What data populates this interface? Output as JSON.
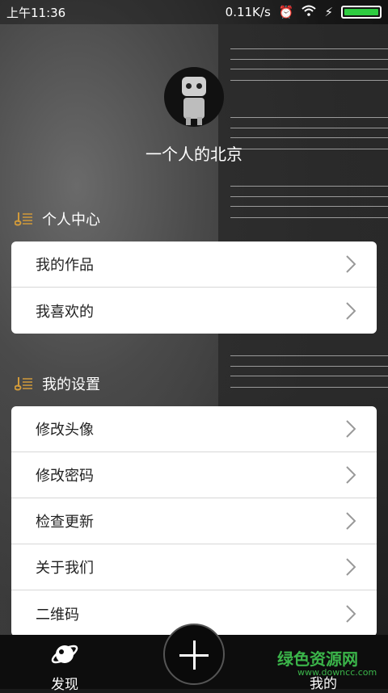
{
  "status_bar": {
    "time": "上午11:36",
    "speed": "0.11K/s"
  },
  "profile": {
    "username": "一个人的北京"
  },
  "sections": [
    {
      "title": "个人中心",
      "items": [
        "我的作品",
        "我喜欢的"
      ]
    },
    {
      "title": "我的设置",
      "items": [
        "修改头像",
        "修改密码",
        "检查更新",
        "关于我们",
        "二维码"
      ]
    }
  ],
  "tabbar": {
    "discover": "发现",
    "mine": "我的"
  },
  "watermark": {
    "text": "绿色资源网",
    "sub": "www.downcc.com"
  },
  "colors": {
    "accent_icon": "#d19a3a",
    "battery": "#2ecc40",
    "watermark": "#3bb54a"
  }
}
